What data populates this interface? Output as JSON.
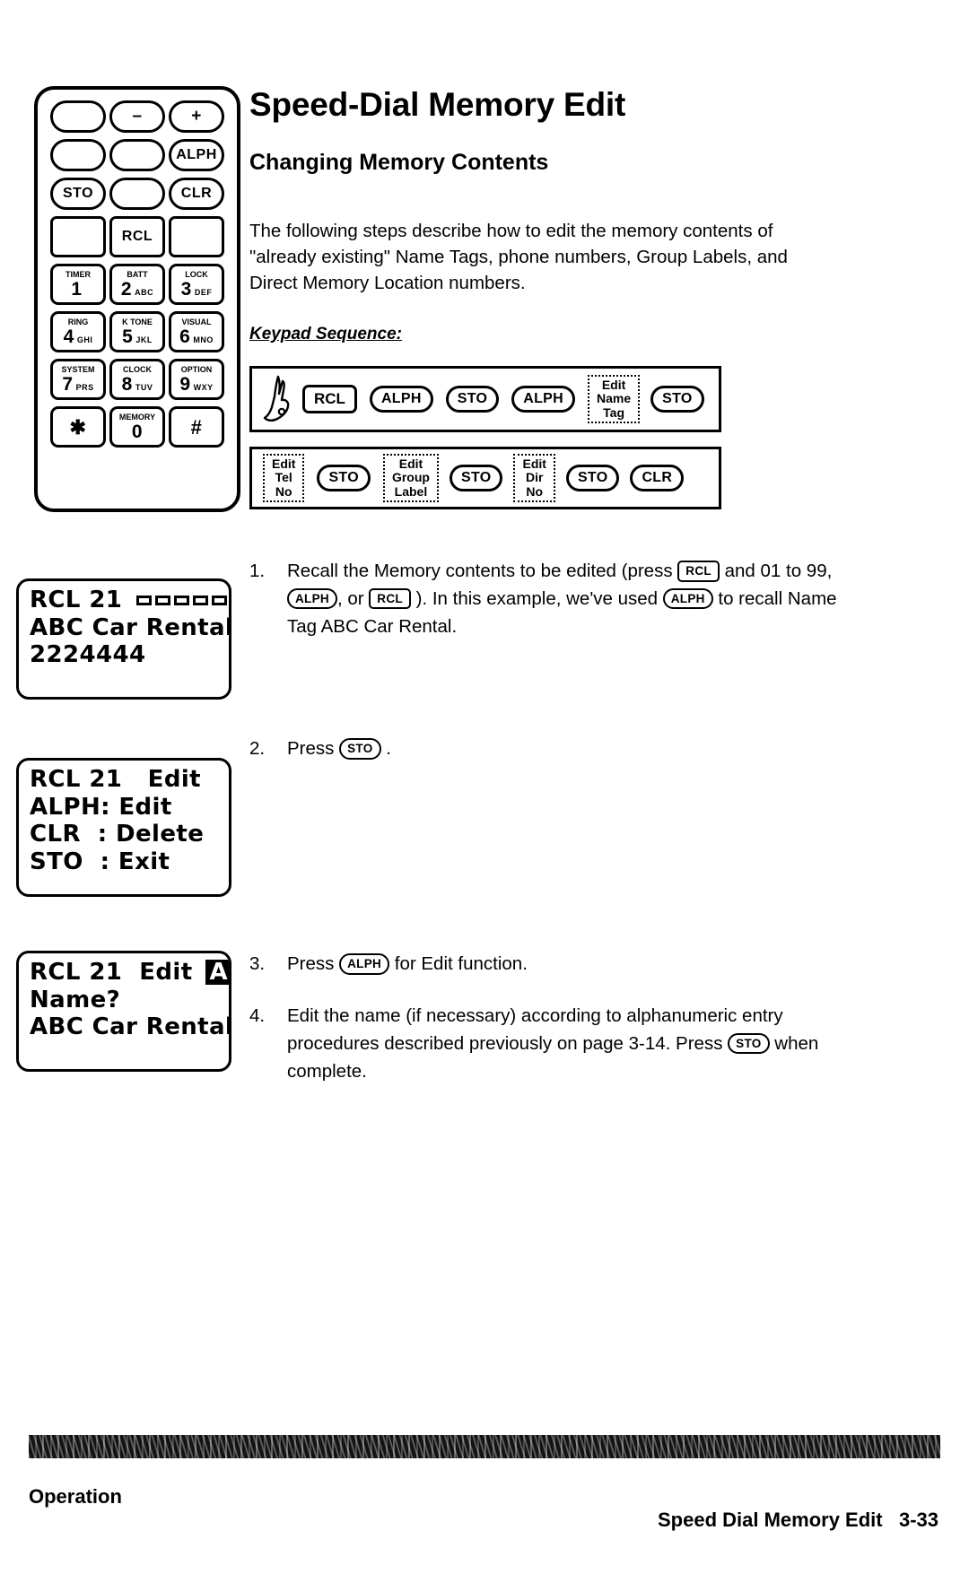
{
  "document": {
    "title": "Speed-Dial Memory Edit",
    "subtitle": "Changing Memory Contents",
    "intro": "The following steps describe how to edit the memory contents of \"already existing\" Name Tags, phone numbers, Group Labels, and Direct Memory Location numbers.",
    "keypad_sequence_label": "Keypad Sequence:"
  },
  "handset": {
    "rows": [
      [
        {
          "label": "",
          "type": "pill"
        },
        {
          "label": "–",
          "type": "pill"
        },
        {
          "label": "+",
          "type": "pill"
        }
      ],
      [
        {
          "label": "",
          "type": "pill"
        },
        {
          "label": "",
          "type": "pill"
        },
        {
          "label": "ALPH",
          "type": "pill"
        }
      ],
      [
        {
          "label": "STO",
          "type": "pill"
        },
        {
          "label": "",
          "type": "pill"
        },
        {
          "label": "CLR",
          "type": "pill"
        }
      ],
      [
        {
          "label": "",
          "type": "square"
        },
        {
          "label": "RCL",
          "type": "square"
        },
        {
          "label": "",
          "type": "square"
        }
      ]
    ],
    "numpad": [
      [
        {
          "top": "TIMER",
          "digit": "1",
          "letters": ""
        },
        {
          "top": "BATT",
          "digit": "2",
          "letters": "ABC"
        },
        {
          "top": "LOCK",
          "digit": "3",
          "letters": "DEF"
        }
      ],
      [
        {
          "top": "RING",
          "digit": "4",
          "letters": "GHI"
        },
        {
          "top": "K TONE",
          "digit": "5",
          "letters": "JKL"
        },
        {
          "top": "VISUAL",
          "digit": "6",
          "letters": "MNO"
        }
      ],
      [
        {
          "top": "SYSTEM",
          "digit": "7",
          "letters": "PRS"
        },
        {
          "top": "CLOCK",
          "digit": "8",
          "letters": "TUV"
        },
        {
          "top": "OPTION",
          "digit": "9",
          "letters": "WXY"
        }
      ],
      [
        {
          "top": "",
          "digit": "✱",
          "letters": ""
        },
        {
          "top": "MEMORY",
          "digit": "0",
          "letters": ""
        },
        {
          "top": "",
          "digit": "#",
          "letters": ""
        }
      ]
    ]
  },
  "keypad_sequence": {
    "row1": [
      {
        "kind": "finger",
        "label": "pointing-hand"
      },
      {
        "kind": "rect",
        "label": "RCL"
      },
      {
        "kind": "pill",
        "label": "ALPH"
      },
      {
        "kind": "pill",
        "label": "STO"
      },
      {
        "kind": "pill",
        "label": "ALPH"
      },
      {
        "kind": "dotted",
        "label": "Edit\nName\nTag"
      },
      {
        "kind": "pill",
        "label": "STO"
      }
    ],
    "row2": [
      {
        "kind": "dotted",
        "label": "Edit\nTel\nNo"
      },
      {
        "kind": "pill",
        "label": "STO"
      },
      {
        "kind": "dotted",
        "label": "Edit\nGroup\nLabel"
      },
      {
        "kind": "pill",
        "label": "STO"
      },
      {
        "kind": "dotted",
        "label": "Edit\nDir\nNo"
      },
      {
        "kind": "pill",
        "label": "STO"
      },
      {
        "kind": "pill",
        "label": "CLR"
      }
    ]
  },
  "displays": {
    "lcd1": {
      "line1": "RCL 21",
      "segments": 5,
      "line2": "ABC Car Rental",
      "line3": "2224444"
    },
    "lcd2": {
      "line1": "RCL 21   Edit",
      "line2": "ALPH: Edit",
      "line3": "CLR  : Delete",
      "line4": "STO  : Exit"
    },
    "lcd3": {
      "line1": "RCL 21  Edit",
      "indicator": "A",
      "line2": "Name?",
      "line3": "ABC Car Rental"
    }
  },
  "steps": [
    {
      "number": "1.",
      "parts": [
        {
          "t": "text",
          "v": "Recall the Memory  contents to be edited (press "
        },
        {
          "t": "rect",
          "v": "RCL"
        },
        {
          "t": "text",
          "v": " and 01 to 99, "
        },
        {
          "t": "pill",
          "v": "ALPH"
        },
        {
          "t": "text",
          "v": ", or "
        },
        {
          "t": "rect",
          "v": "RCL"
        },
        {
          "t": "text",
          "v": " ).  In this example, we've used "
        },
        {
          "t": "pill",
          "v": "ALPH"
        },
        {
          "t": "text",
          "v": " to recall Name Tag ABC Car Rental."
        }
      ]
    },
    {
      "number": "2.",
      "parts": [
        {
          "t": "text",
          "v": "Press "
        },
        {
          "t": "pill",
          "v": "STO"
        },
        {
          "t": "text",
          "v": " ."
        }
      ]
    },
    {
      "number": "3.",
      "parts": [
        {
          "t": "text",
          "v": "Press "
        },
        {
          "t": "pill",
          "v": "ALPH"
        },
        {
          "t": "text",
          "v": " for Edit function."
        }
      ]
    },
    {
      "number": "4.",
      "parts": [
        {
          "t": "text",
          "v": "Edit the name (if necessary) according to alphanumeric entry procedures described previously on page 3-14. Press "
        },
        {
          "t": "pill",
          "v": "STO"
        },
        {
          "t": "text",
          "v": " when complete."
        }
      ]
    }
  ],
  "footer": {
    "left": "Operation",
    "right": "Speed Dial Memory Edit",
    "page": "3-33"
  }
}
